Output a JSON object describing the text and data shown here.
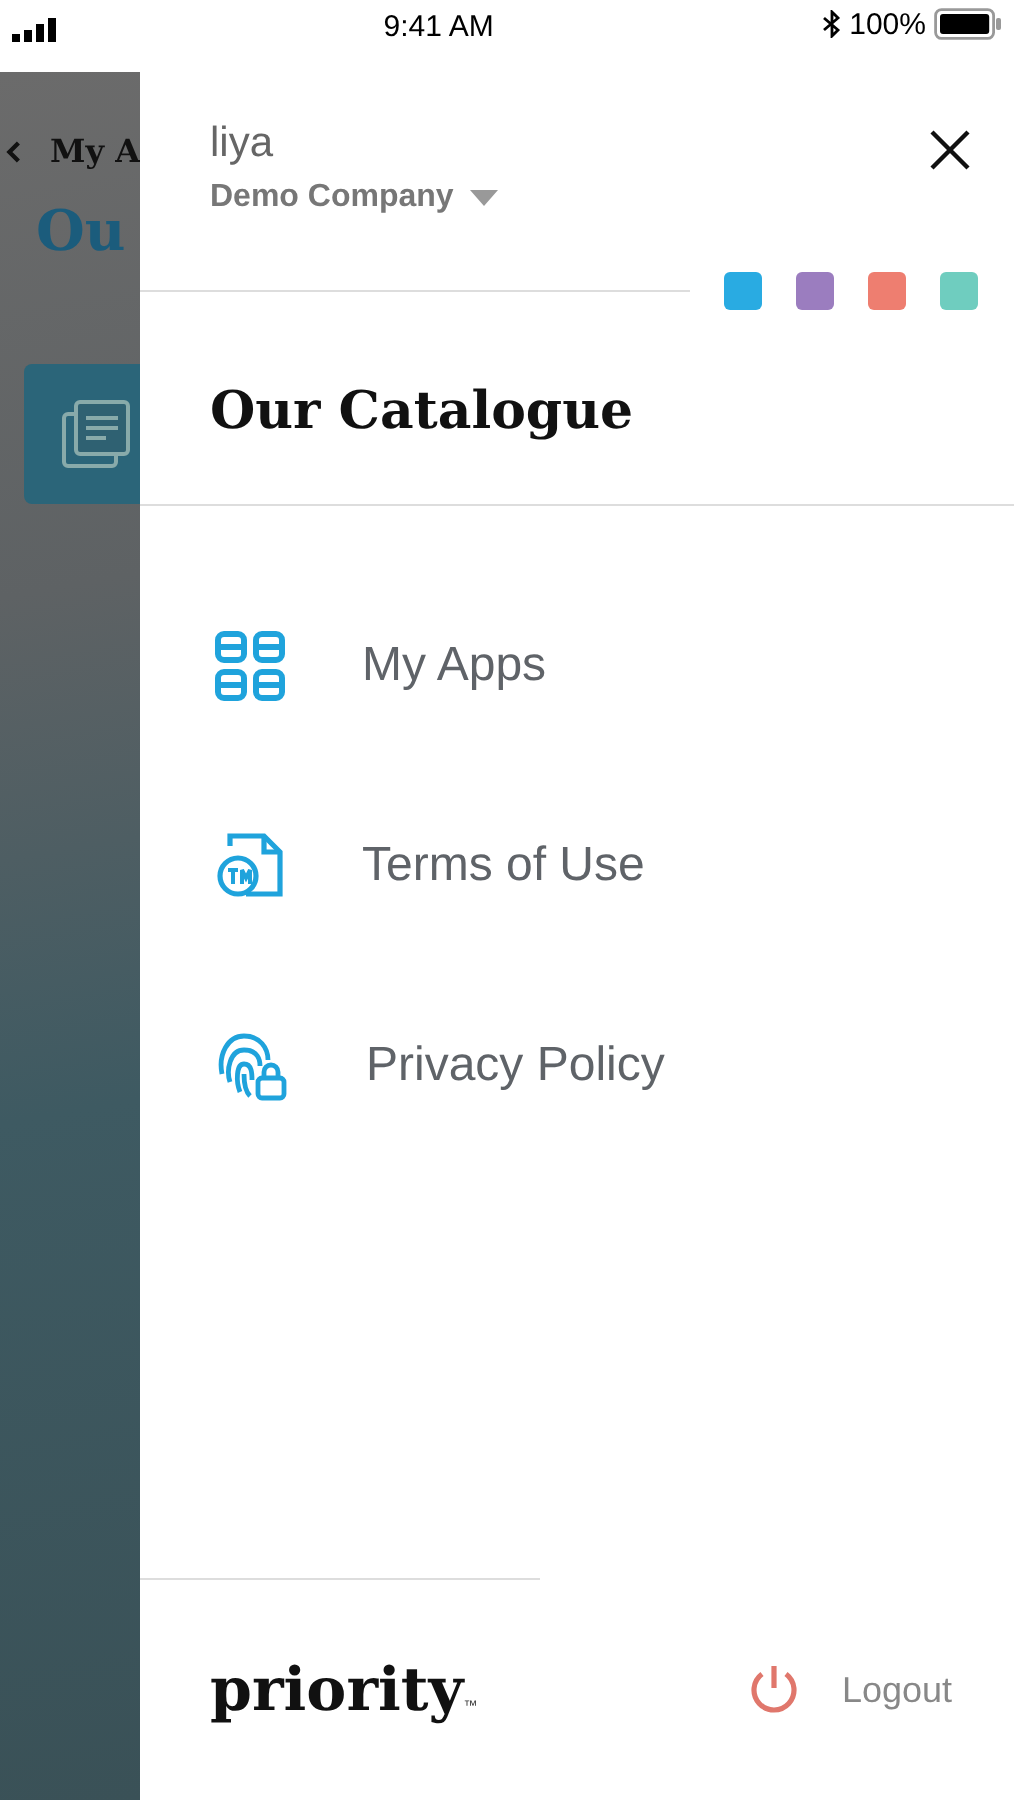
{
  "status_bar": {
    "time": "9:41 AM",
    "battery": "100%"
  },
  "background_screen": {
    "title": "My A",
    "heading": "Ou"
  },
  "drawer": {
    "user": {
      "name": "liya",
      "company": "Demo Company"
    },
    "themes": [
      {
        "color": "#29abe2"
      },
      {
        "color": "#9b7dbf"
      },
      {
        "color": "#ee7e70"
      },
      {
        "color": "#6fcdbf"
      }
    ],
    "title": "Our Catalogue",
    "menu": [
      {
        "label": "My Apps",
        "kind": "apps"
      },
      {
        "label": "Terms of Use",
        "kind": "terms"
      },
      {
        "label": "Privacy Policy",
        "kind": "privacy"
      }
    ],
    "logo": {
      "text": "priority",
      "mark": "™"
    },
    "logout": "Logout"
  }
}
